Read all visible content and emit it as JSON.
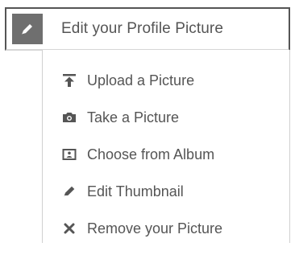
{
  "header": {
    "title": "Edit your Profile Picture",
    "icon": "pencil-icon"
  },
  "menu": {
    "items": [
      {
        "label": "Upload a Picture",
        "icon": "upload-icon"
      },
      {
        "label": "Take a Picture",
        "icon": "camera-icon"
      },
      {
        "label": "Choose from Album",
        "icon": "album-icon"
      },
      {
        "label": "Edit Thumbnail",
        "icon": "pencil-icon"
      },
      {
        "label": "Remove your Picture",
        "icon": "close-icon"
      }
    ]
  },
  "colors": {
    "text": "#555555",
    "icon_box": "#6f6f6f",
    "border": "#555555"
  }
}
